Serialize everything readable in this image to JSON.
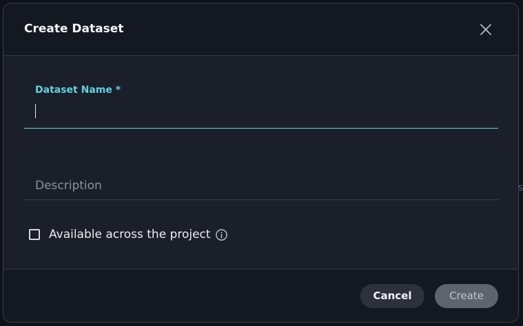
{
  "background": {
    "edge_glyph": "s"
  },
  "dialog": {
    "title": "Create Dataset",
    "close_icon": "close-icon",
    "fields": {
      "name": {
        "label": "Dataset Name *",
        "value": "",
        "accent_color": "#62d2e0"
      },
      "description": {
        "placeholder": "Description",
        "value": ""
      }
    },
    "options": {
      "available_across_project": {
        "label": "Available across the project",
        "checked": false,
        "info_icon": "info-icon"
      }
    },
    "footer": {
      "cancel_label": "Cancel",
      "create_label": "Create"
    }
  }
}
